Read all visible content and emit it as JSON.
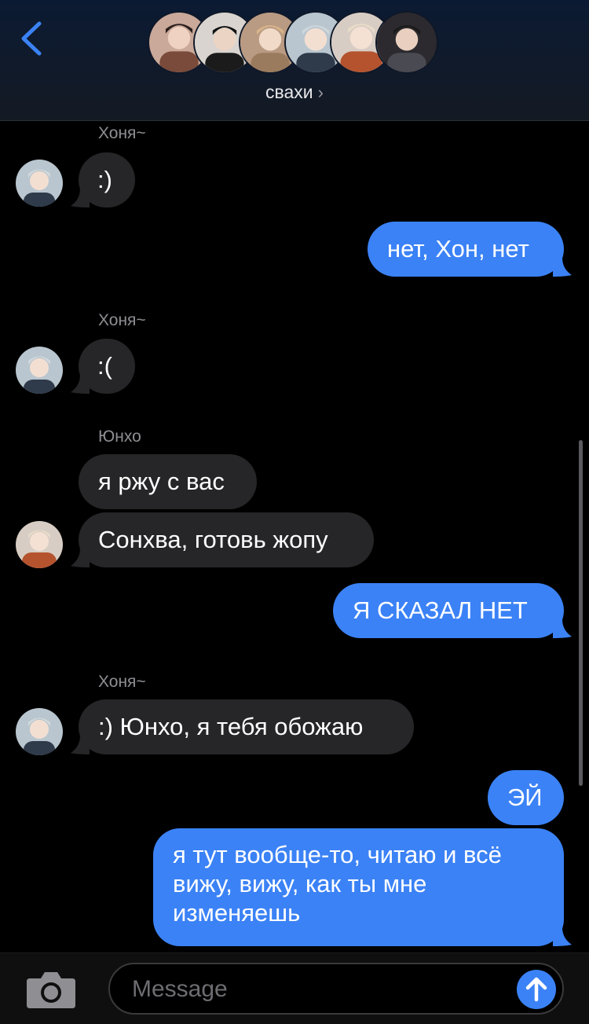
{
  "header": {
    "group_name": "свахи",
    "chevron": "›",
    "back_icon": "chevron-left-icon",
    "accent": "#3b82f6"
  },
  "messages": [
    {
      "sender": "Хоня~",
      "text": ":)",
      "side": "in"
    },
    {
      "text": "нет, Хон, нет",
      "side": "out"
    },
    {
      "sender": "Хоня~",
      "text": ":(",
      "side": "in"
    },
    {
      "sender": "Юнхо",
      "text": "я ржу с вас",
      "side": "in"
    },
    {
      "text": "Сонхва, готовь жопу",
      "side": "in"
    },
    {
      "text": "Я СКАЗАЛ НЕТ",
      "side": "out"
    },
    {
      "sender": "Хоня~",
      "text": ":) Юнхо, я тебя обожаю",
      "side": "in"
    },
    {
      "text": "ЭЙ",
      "side": "out"
    },
    {
      "lines": [
        "я тут вообще-то, читаю и всё",
        "вижу, вижу, как ты мне",
        "изменяешь"
      ],
      "side": "out"
    }
  ],
  "composer": {
    "placeholder": "Message",
    "camera_icon": "camera-icon",
    "send_icon": "arrow-up-icon"
  },
  "colors": {
    "incoming_bubble": "#262628",
    "outgoing_bubble": "#3b82f6",
    "sender_text": "#8e8e93"
  }
}
